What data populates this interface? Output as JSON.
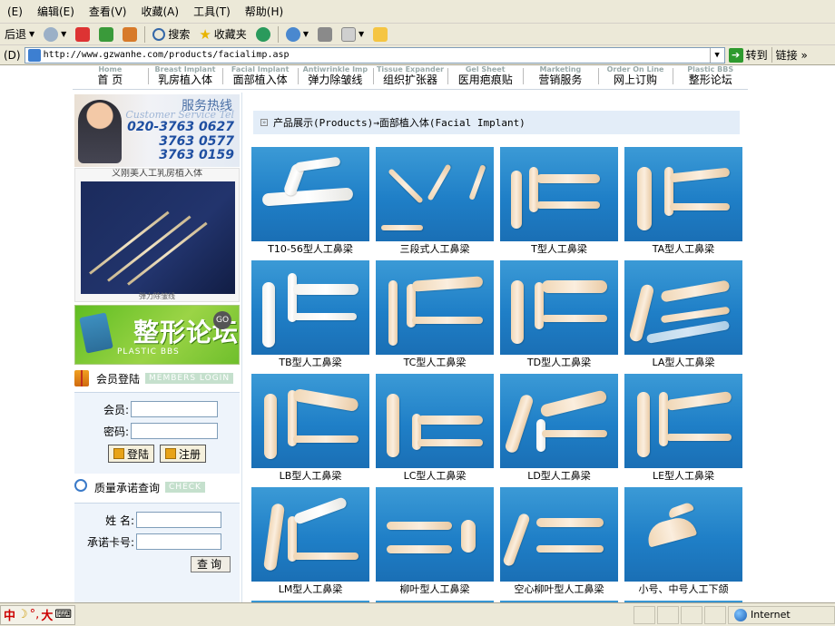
{
  "browser": {
    "menu": [
      "(E)",
      "编辑(E)",
      "查看(V)",
      "收藏(A)",
      "工具(T)",
      "帮助(H)"
    ],
    "toolbar": {
      "back": "后退",
      "search": "搜索",
      "favorites": "收藏夹"
    },
    "address": {
      "label": "(D)",
      "url": "http://www.gzwanhe.com/products/facialimp.asp",
      "go": "转到",
      "links": "链接"
    },
    "status": {
      "ime_text": "中",
      "ime_big": "大",
      "zone": "Internet"
    }
  },
  "site": {
    "nav": [
      {
        "en": "Home",
        "cn": "首 页"
      },
      {
        "en": "Breast Implant",
        "cn": "乳房植入体"
      },
      {
        "en": "Facial Implant",
        "cn": "面部植入体"
      },
      {
        "en": "Antiwrinkle Imp",
        "cn": "弹力除皱线"
      },
      {
        "en": "Tissue Expander",
        "cn": "组织扩张器"
      },
      {
        "en": "Gel Sheet",
        "cn": "医用疤痕贴"
      },
      {
        "en": "Marketing",
        "cn": "营销服务"
      },
      {
        "en": "Order On Line",
        "cn": "网上订购"
      },
      {
        "en": "Plastic BBS",
        "cn": "整形论坛"
      }
    ],
    "hotline": {
      "title": "服务热线",
      "subtitle": "Customer Service Tel",
      "phones": [
        "020-3763 0627",
        "3763 0577",
        "3763 0159"
      ]
    },
    "promo": {
      "caption_top": "义刚美人工乳房植入体",
      "caption_bottom": "弹力除皱线"
    },
    "bbs": {
      "cn": "整形论坛",
      "en": "PLASTIC BBS",
      "go": "GO"
    },
    "login": {
      "title": "会员登陆",
      "badge": "MEMBERS LOGIN",
      "member_label": "会员:",
      "password_label": "密码:",
      "login_btn": "登陆",
      "register_btn": "注册"
    },
    "quality": {
      "title": "质量承诺查询",
      "badge": "CHECK",
      "name_label": "姓 名:",
      "card_label": "承诺卡号:",
      "query_btn": "查询"
    },
    "breadcrumb": "产品展示(Products)→面部植入体(Facial Implant)",
    "products": [
      "T10-56型人工鼻梁",
      "三段式人工鼻梁",
      "T型人工鼻梁",
      "TA型人工鼻梁",
      "TB型人工鼻梁",
      "TC型人工鼻梁",
      "TD型人工鼻梁",
      "LA型人工鼻梁",
      "LB型人工鼻梁",
      "LC型人工鼻梁",
      "LD型人工鼻梁",
      "LE型人工鼻梁",
      "LM型人工鼻梁",
      "柳叶型人工鼻梁",
      "空心柳叶型人工鼻梁",
      "小号、中号人工下颌"
    ]
  }
}
